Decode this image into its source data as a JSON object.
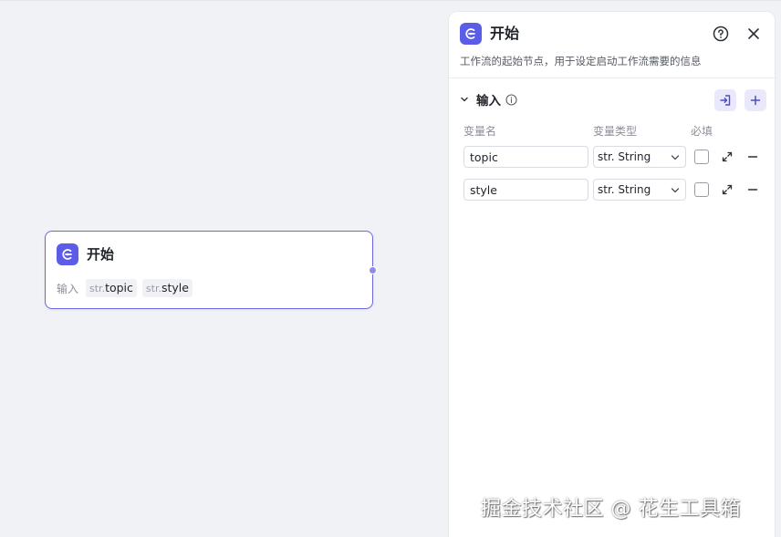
{
  "canvas": {
    "node": {
      "title": "开始",
      "inputs_label": "输入",
      "variables": [
        {
          "type": "str.",
          "name": "topic"
        },
        {
          "type": "str.",
          "name": "style"
        }
      ]
    }
  },
  "panel": {
    "title": "开始",
    "description": "工作流的起始节点，用于设定启动工作流需要的信息",
    "section_title": "输入",
    "columns": {
      "name": "变量名",
      "type": "变量类型",
      "required": "必填"
    },
    "rows": [
      {
        "name": "topic",
        "type": "str. String",
        "required": false
      },
      {
        "name": "style",
        "type": "str. String",
        "required": false
      }
    ]
  },
  "watermark": "掘金技术社区 @ 花生工具箱",
  "colors": {
    "accent": "#5b5ce8",
    "node_border": "#6a68e0",
    "canvas_bg": "#f1f2f6"
  },
  "icons": {
    "node": "start-node-icon",
    "help": "help-circle-icon",
    "close": "close-icon",
    "collapse": "chevron-down-icon",
    "info": "info-icon",
    "import": "import-icon",
    "add": "plus-icon",
    "expand": "expand-icon",
    "remove": "minus-icon"
  }
}
